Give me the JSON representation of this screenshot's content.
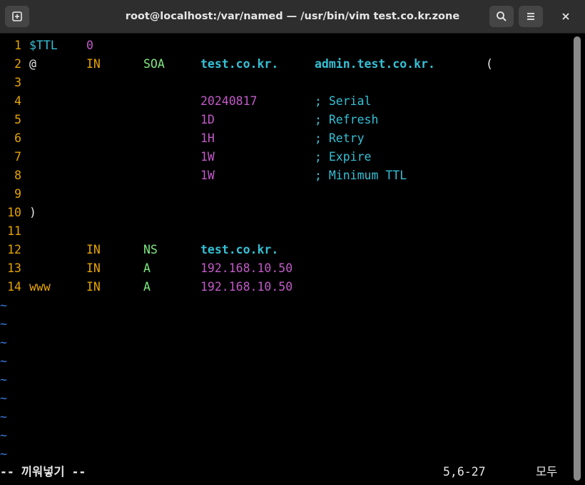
{
  "window": {
    "title": "root@localhost:/var/named — /usr/bin/vim test.co.kr.zone",
    "buttons": {
      "new_tab": "new-tab-icon",
      "search": "search-icon",
      "menu": "hamburger-menu-icon",
      "close": "close-icon"
    }
  },
  "editor": {
    "lines": [
      {
        "num": "1",
        "c1": "$TTL",
        "c2": "0"
      },
      {
        "num": "2",
        "c1": "@",
        "c2": "IN",
        "c3": "SOA",
        "c4": "test.co.kr.",
        "c5": "admin.test.co.kr.",
        "c6": "("
      },
      {
        "num": "3"
      },
      {
        "num": "4",
        "value": "20240817",
        "comment": "; Serial"
      },
      {
        "num": "5",
        "value": "1D",
        "comment": "; Refresh"
      },
      {
        "num": "6",
        "value": "1H",
        "comment": "; Retry"
      },
      {
        "num": "7",
        "value": "1W",
        "comment": "; Expire"
      },
      {
        "num": "8",
        "value": "1W",
        "comment": "; Minimum TTL"
      },
      {
        "num": "9"
      },
      {
        "num": "10",
        "c1": ")"
      },
      {
        "num": "11"
      },
      {
        "num": "12",
        "c2": "IN",
        "c3": "NS",
        "c4": "test.co.kr."
      },
      {
        "num": "13",
        "c2": "IN",
        "c3": "A",
        "c4": "192.168.10.50"
      },
      {
        "num": "14",
        "c1": "www",
        "c2": "IN",
        "c3": "A",
        "c4": "192.168.10.50"
      }
    ],
    "tilde": "~",
    "tilde_count": 9
  },
  "statusbar": {
    "mode": "-- 끼워넣기 --",
    "position": "5,6-27",
    "scope": "모두"
  },
  "colors": {
    "line_number": "#e6a400",
    "keyword_cyan": "#35c0d6",
    "number_magenta": "#c25ac9",
    "type_green": "#7fe87f",
    "tilde_blue": "#3d7be0",
    "background": "#000000"
  }
}
